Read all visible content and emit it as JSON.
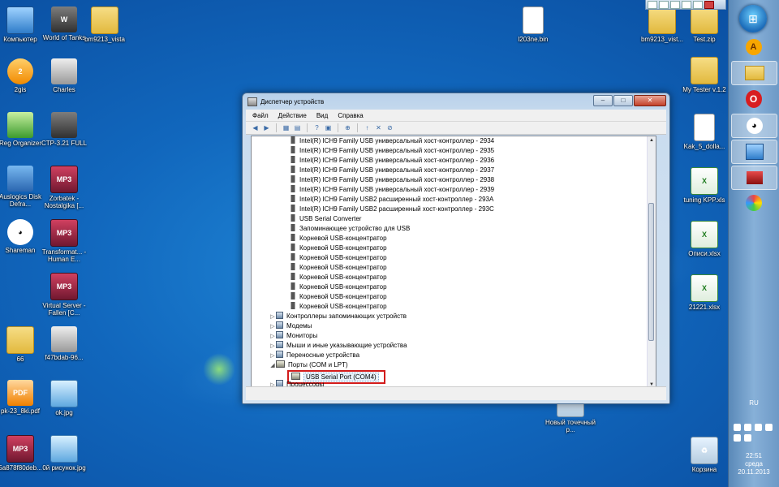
{
  "colors": {
    "desktop_bg": "#1167bd",
    "highlight_box": "#d21b1b",
    "taskbar": "#6d99c6"
  },
  "desktop_icons": [
    {
      "label": "Компьютер",
      "icon": "computer-icon",
      "kind": "computer",
      "glyph": ""
    },
    {
      "label": "World of Tanks",
      "icon": "tank-icon",
      "kind": "tank",
      "glyph": "W"
    },
    {
      "label": "bm9213_vista",
      "icon": "folder-icon",
      "kind": "folder",
      "glyph": ""
    },
    {
      "label": "2gis",
      "icon": "2gis-icon",
      "kind": "orange",
      "glyph": "2"
    },
    {
      "label": "Charles",
      "icon": "teapot-icon",
      "kind": "gray",
      "glyph": ""
    },
    {
      "label": "Reg Organizer",
      "icon": "reg-organizer-icon",
      "kind": "green",
      "glyph": ""
    },
    {
      "label": "CTP-3.21 FULL",
      "icon": "app-icon",
      "kind": "tank",
      "glyph": ""
    },
    {
      "label": "Auslogics Disk Defra...",
      "icon": "auslogics-icon",
      "kind": "blue",
      "glyph": ""
    },
    {
      "label": "Zorbatek - Nostalgika [...",
      "icon": "mp3-icon",
      "kind": "mp3",
      "glyph": "MP3"
    },
    {
      "label": "Shareman",
      "icon": "panda-icon",
      "kind": "panda",
      "glyph": "◕"
    },
    {
      "label": "Transformat... - Human E...",
      "icon": "mp3-icon",
      "kind": "mp3",
      "glyph": "MP3"
    },
    {
      "label": "Virtual Server - Fallen [C...",
      "icon": "mp3-icon",
      "kind": "mp3",
      "glyph": "MP3"
    },
    {
      "label": "66",
      "icon": "folder-icon",
      "kind": "folder",
      "glyph": ""
    },
    {
      "label": "f47bdab-96...",
      "icon": "image-icon",
      "kind": "gray",
      "glyph": ""
    },
    {
      "label": "pk-23_8ki.pdf",
      "icon": "pdf-icon",
      "kind": "pdf",
      "glyph": "PDF"
    },
    {
      "label": "ok.jpg",
      "icon": "jpg-icon",
      "kind": "jpg",
      "glyph": ""
    },
    {
      "label": "5a878f80deb...",
      "icon": "mp3-icon",
      "kind": "mp3",
      "glyph": "MP3"
    },
    {
      "label": "0й рисунок.jpg",
      "icon": "jpg-icon",
      "kind": "jpg",
      "glyph": ""
    },
    {
      "label": "l203ne.bin",
      "icon": "file-icon",
      "kind": "file",
      "glyph": ""
    },
    {
      "label": "bm9213_vist...",
      "icon": "folder-icon",
      "kind": "folder",
      "glyph": ""
    },
    {
      "label": "Test.zip",
      "icon": "zip-folder-icon",
      "kind": "folder",
      "glyph": ""
    },
    {
      "label": "My Tester v.1.2",
      "icon": "folder-icon",
      "kind": "folder",
      "glyph": ""
    },
    {
      "label": "Kak_5_dolla...",
      "icon": "file-icon",
      "kind": "file",
      "glyph": ""
    },
    {
      "label": "tuning KPP.xls",
      "icon": "excel-icon",
      "kind": "excel",
      "glyph": "X"
    },
    {
      "label": "Описи.xlsx",
      "icon": "excel-icon",
      "kind": "excel",
      "glyph": "X"
    },
    {
      "label": "21221.xlsx",
      "icon": "excel-icon",
      "kind": "excel",
      "glyph": "X"
    },
    {
      "label": "Новый точечный р...",
      "icon": "bmp-icon",
      "kind": "bin",
      "glyph": ""
    },
    {
      "label": "Корзина",
      "icon": "recycle-bin-icon",
      "kind": "bin",
      "glyph": "♻"
    }
  ],
  "window": {
    "title": "Диспетчер устройств",
    "menu": [
      "Файл",
      "Действие",
      "Вид",
      "Справка"
    ],
    "controls": {
      "minimize": "–",
      "maximize": "□",
      "close": "✕"
    },
    "tree_rows": [
      {
        "text": "Intel(R) ICH9 Family USB универсальный хост-контроллер  - 2934",
        "level": 2,
        "icon": "usb"
      },
      {
        "text": "Intel(R) ICH9 Family USB универсальный хост-контроллер  - 2935",
        "level": 2,
        "icon": "usb"
      },
      {
        "text": "Intel(R) ICH9 Family USB универсальный хост-контроллер  - 2936",
        "level": 2,
        "icon": "usb"
      },
      {
        "text": "Intel(R) ICH9 Family USB универсальный хост-контроллер  - 2937",
        "level": 2,
        "icon": "usb"
      },
      {
        "text": "Intel(R) ICH9 Family USB универсальный хост-контроллер  - 2938",
        "level": 2,
        "icon": "usb"
      },
      {
        "text": "Intel(R) ICH9 Family USB универсальный хост-контроллер  - 2939",
        "level": 2,
        "icon": "usb"
      },
      {
        "text": "Intel(R) ICH9 Family USB2 расширенный хост-контроллер  - 293A",
        "level": 2,
        "icon": "usb"
      },
      {
        "text": "Intel(R) ICH9 Family USB2 расширенный хост-контроллер  - 293C",
        "level": 2,
        "icon": "usb"
      },
      {
        "text": "USB Serial Converter",
        "level": 2,
        "icon": "usb"
      },
      {
        "text": "Запоминающее устройство для USB",
        "level": 2,
        "icon": "usb"
      },
      {
        "text": "Корневой USB-концентратор",
        "level": 2,
        "icon": "usb"
      },
      {
        "text": "Корневой USB-концентратор",
        "level": 2,
        "icon": "usb"
      },
      {
        "text": "Корневой USB-концентратор",
        "level": 2,
        "icon": "usb"
      },
      {
        "text": "Корневой USB-концентратор",
        "level": 2,
        "icon": "usb"
      },
      {
        "text": "Корневой USB-концентратор",
        "level": 2,
        "icon": "usb"
      },
      {
        "text": "Корневой USB-концентратор",
        "level": 2,
        "icon": "usb"
      },
      {
        "text": "Корневой USB-концентратор",
        "level": 2,
        "icon": "usb"
      },
      {
        "text": "Корневой USB-концентратор",
        "level": 2,
        "icon": "usb"
      },
      {
        "text": "Контроллеры запоминающих устройств",
        "level": 1,
        "icon": "cat",
        "expander": "▷"
      },
      {
        "text": "Модемы",
        "level": 1,
        "icon": "cat",
        "expander": "▷"
      },
      {
        "text": "Мониторы",
        "level": 1,
        "icon": "cat",
        "expander": "▷"
      },
      {
        "text": "Мыши и иные указывающие устройства",
        "level": 1,
        "icon": "cat",
        "expander": "▷"
      },
      {
        "text": "Переносные устройства",
        "level": 1,
        "icon": "cat",
        "expander": "▷"
      },
      {
        "text": "Порты (COM и LPT)",
        "level": 1,
        "icon": "port",
        "expander": "◢"
      },
      {
        "text": "USB Serial Port (COM4)",
        "level": 2,
        "icon": "port",
        "selected": true
      },
      {
        "text": "Процессоры",
        "level": 1,
        "icon": "cat",
        "expander": "▷"
      }
    ]
  },
  "taskbar": {
    "language": "RU",
    "time": "22:51",
    "day": "среда",
    "date": "20.11.2013"
  }
}
